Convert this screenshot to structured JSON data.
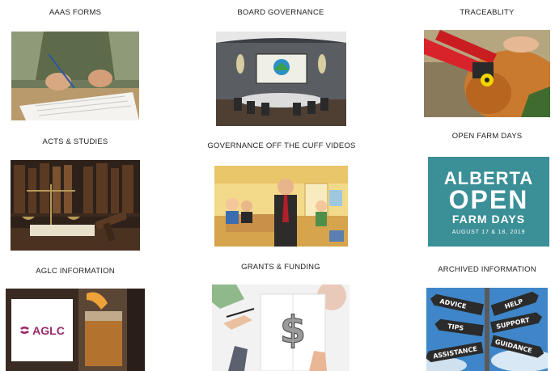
{
  "tiles": [
    {
      "label": "AAAS FORMS",
      "icon": "signing-form-photo"
    },
    {
      "label": "BOARD GOVERNANCE",
      "icon": "boardroom-photo"
    },
    {
      "label": "TRACEABLITY",
      "icon": "cattle-ear-tag-photo"
    },
    {
      "label": "ACTS & STUDIES",
      "icon": "law-gavel-photo"
    },
    {
      "label": "GOVERNANCE OFF THE CUFF VIDEOS",
      "icon": "cartoon-presenter-photo"
    },
    {
      "label": "OPEN FARM DAYS",
      "icon": "open-farm-days-banner"
    },
    {
      "label": "AGLC INFORMATION",
      "icon": "aglc-drink-photo"
    },
    {
      "label": "GRANTS & FUNDING",
      "icon": "dollar-sketch-photo"
    },
    {
      "label": "ARCHIVED INFORMATION",
      "icon": "signpost-photo"
    }
  ],
  "open_farm_days": {
    "line1": "ALBERTA",
    "line2": "OPEN",
    "line3": "FARM DAYS",
    "dates": "AUGUST 17 & 18, 2019",
    "bg_color": "#3b8f97"
  },
  "aglc": {
    "logo_text": "AGLC",
    "brand_color": "#9b2a6a"
  },
  "signpost": {
    "signs": [
      "ADVICE",
      "HELP",
      "TIPS",
      "SUPPORT",
      "ASSISTANCE",
      "GUIDANCE"
    ]
  }
}
